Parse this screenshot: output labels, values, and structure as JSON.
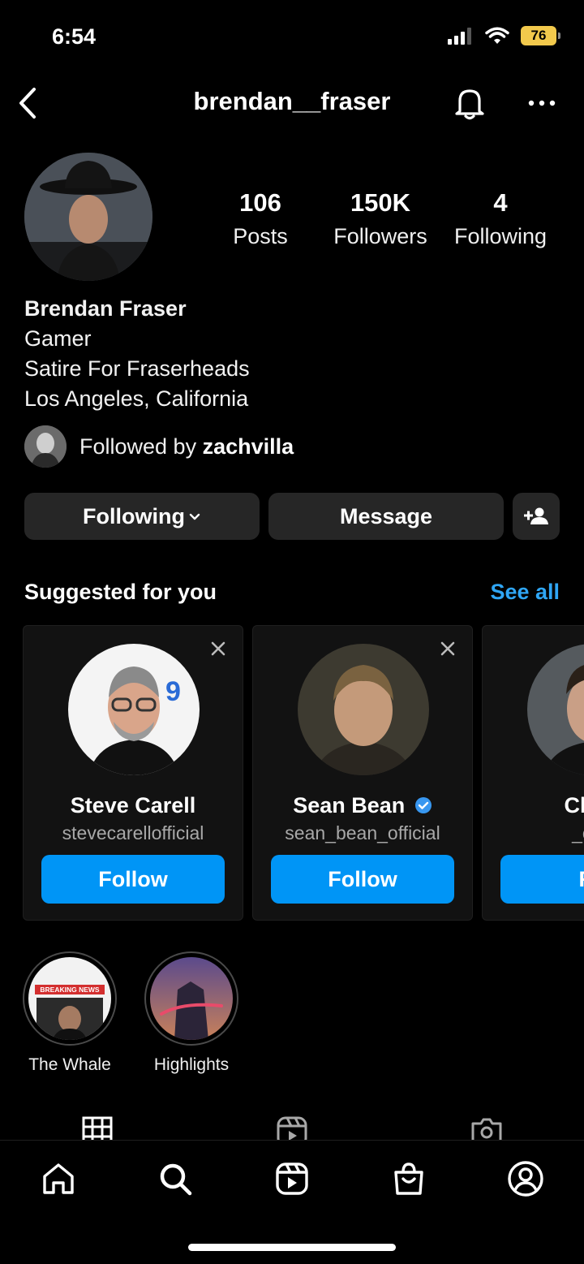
{
  "status_bar": {
    "time": "6:54",
    "battery": "76"
  },
  "header": {
    "username": "brendan__fraser"
  },
  "stats": [
    {
      "value": "106",
      "label": "Posts"
    },
    {
      "value": "150K",
      "label": "Followers"
    },
    {
      "value": "4",
      "label": "Following"
    }
  ],
  "bio": {
    "name": "Brendan Fraser",
    "lines": [
      "Gamer",
      "Satire For Fraserheads",
      "Los Angeles, California"
    ]
  },
  "followed_by": {
    "prefix": "Followed by ",
    "user": "zachvilla"
  },
  "actions": {
    "following": "Following",
    "message": "Message"
  },
  "suggested": {
    "title": "Suggested for you",
    "see_all": "See all",
    "cards": [
      {
        "name": "Steve Carell",
        "handle": "stevecarellofficial",
        "button": "Follow"
      },
      {
        "name": "Sean Bean",
        "handle": "sean_bean_official",
        "button": "Follow",
        "verified": true
      },
      {
        "name": "Charl",
        "handle": "_cha",
        "button": "Fo"
      }
    ]
  },
  "highlights": [
    {
      "label": "The Whale"
    },
    {
      "label": "Highlights"
    }
  ],
  "highlight_art": {
    "breaking": "BREAKING NEWS"
  },
  "colors": {
    "accent": "#0095f6",
    "link": "#2fa6f5",
    "battery": "#f2c94c"
  },
  "icons": {
    "back": "chevron-left-icon",
    "bell": "bell-icon",
    "more": "more-horizontal-icon",
    "add_user": "add-person-icon",
    "close": "close-icon",
    "verified": "verified-badge-icon",
    "tabs": [
      "grid-icon",
      "reels-icon",
      "tagged-icon"
    ],
    "nav": [
      "home-icon",
      "search-icon",
      "reels-icon",
      "shop-icon",
      "profile-icon"
    ]
  }
}
